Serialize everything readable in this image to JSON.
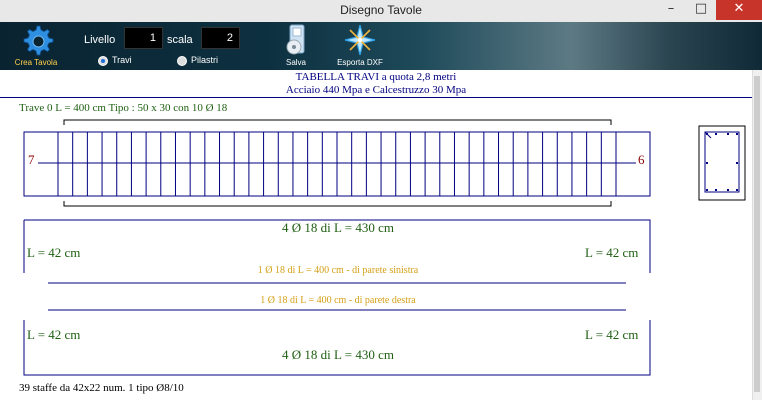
{
  "window": {
    "title": "Disegno Tavole",
    "minimize": "–",
    "maximize": "□",
    "close": "✕"
  },
  "toolbar": {
    "crea_tavola": "Crea Tavola",
    "livello_label": "Livello",
    "livello_value": "1",
    "scala_label": "scala",
    "scala_value": "2",
    "radio_travi": "Travi",
    "radio_pilastri": "Pilastri",
    "selected": "Travi",
    "salva": "Salva",
    "esporta_dxf": "Esporta DXF"
  },
  "drawing": {
    "header_line1": "TABELLA TRAVI a quota 2,8 metri",
    "header_line2": "Acciaio 440 Mpa e Calcestruzzo 30 Mpa",
    "beam_info": "Trave 0 L = 400 cm  Tipo : 50 x 30 con 10 Ø 18",
    "left_node": "7",
    "right_node": "6",
    "bars_top_label": "4 Ø 18 di L = 430 cm",
    "bars_bottom_label": "4 Ø 18 di L = 430 cm",
    "hook_top_left": "L = 42 cm",
    "hook_top_right": "L = 42 cm",
    "hook_bottom_left": "L = 42 cm",
    "hook_bottom_right": "L = 42 cm",
    "side_bar_left": "1 Ø 18 di L = 400 cm - di parete sinistra",
    "side_bar_right": "1 Ø 18 di L = 400 cm - di parete destra",
    "stirrups_note": "39 staffe da 42x22 num. 1 tipo Ø8/10",
    "stirrup_count": 39,
    "colors": {
      "navy": "#000080",
      "red": "#8b0000",
      "green": "#1f5f12",
      "gold": "#d4a017"
    }
  }
}
